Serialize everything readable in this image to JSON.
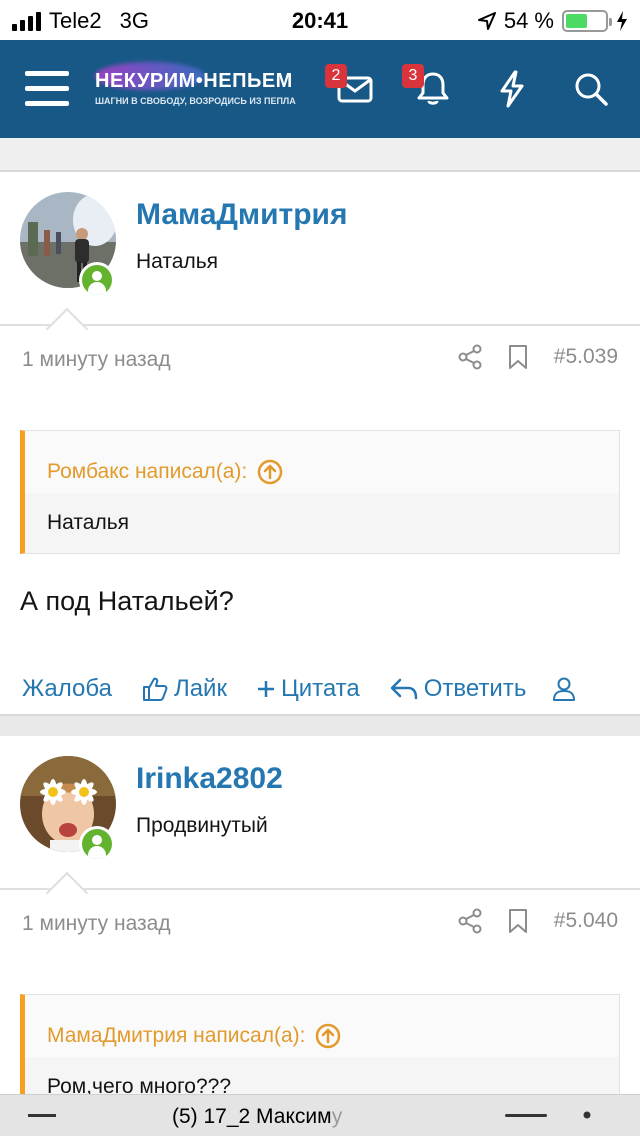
{
  "status_bar": {
    "carrier": "Tele2",
    "network": "3G",
    "time": "20:41",
    "battery": "54 %",
    "battery_level": 0.54
  },
  "header": {
    "logo_title": "НЕКУРИМ•НЕПЬЕМ",
    "logo_subtitle": "ШАГНИ В СВОБОДУ, ВОЗРОДИСЬ ИЗ ПЕПЛА",
    "inbox_badge": "2",
    "alerts_badge": "3",
    "icons": [
      "menu-icon",
      "envelope-icon",
      "bell-icon",
      "lightning-icon",
      "search-icon"
    ]
  },
  "posts": [
    {
      "username": "МамаДмитрия",
      "user_title": "Наталья",
      "time": "1 минуту назад",
      "number": "#5.039",
      "quote_author": "Ромбакс написал(а):",
      "quote_text": "Наталья",
      "text": "А под Натальей?"
    },
    {
      "username": "Irinka2802",
      "user_title": "Продвинутый",
      "time": "1 минуту назад",
      "number": "#5.040",
      "quote_author": "МамаДмитрия написал(а):",
      "quote_text": "Ром,чего много???"
    }
  ],
  "actions": {
    "report": "Жалоба",
    "like": "Лайк",
    "quote": "Цитата",
    "reply": "Ответить"
  },
  "bottom_bar": {
    "title_main": "(5) 17_2 Максим",
    "title_fade": "у"
  },
  "colors": {
    "header": "#185886",
    "link": "#2577b1",
    "quote_accent": "#f6a021",
    "online": "#63b32f",
    "badge": "#d9343b"
  }
}
